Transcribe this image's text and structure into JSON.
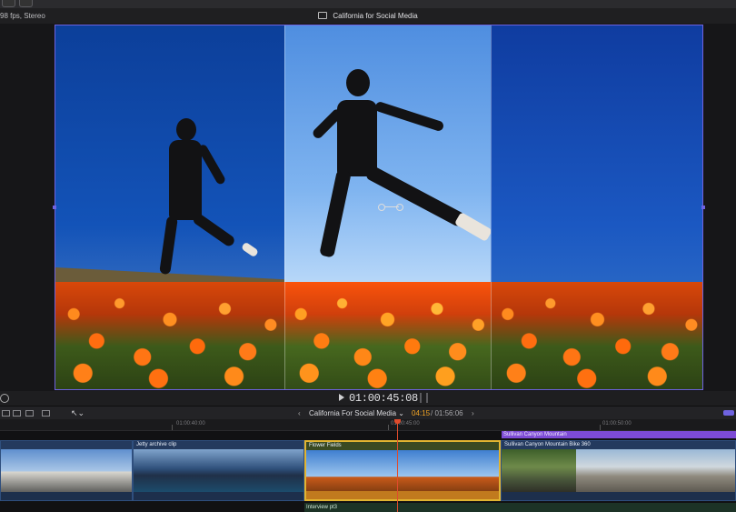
{
  "toolbar": {
    "format_info": "98 fps, Stereo",
    "project_title": "California for Social Media"
  },
  "viewer": {
    "timecode": "01:00:45:08"
  },
  "timeline_header": {
    "nav_left": "‹",
    "title": "California For Social Media ⌄",
    "time_current": "04:15",
    "time_total": "/ 01:56:06",
    "nav_right": "›"
  },
  "ruler": {
    "labels": [
      "01:00:40:00",
      "01:00:45:00",
      "01:00:50:00"
    ]
  },
  "clips": {
    "connected": "Sullivan Canyon Mountain",
    "jetty": "Jetty archive clip",
    "flower": "Flower Fields",
    "sullivan_bike": "Sullivan Canyon Mountain Bike 360",
    "audio": "Interview pt3"
  },
  "colors": {
    "accent": "#6f63e0",
    "playhead": "#e04b2c",
    "selection": "#e1b431",
    "connected_clip": "#7d4bd6",
    "timecode_current": "#f5a623"
  },
  "icons": [
    "film-icon",
    "play-icon",
    "view-options-icon",
    "arrow-tool-icon",
    "snapping-icon"
  ]
}
